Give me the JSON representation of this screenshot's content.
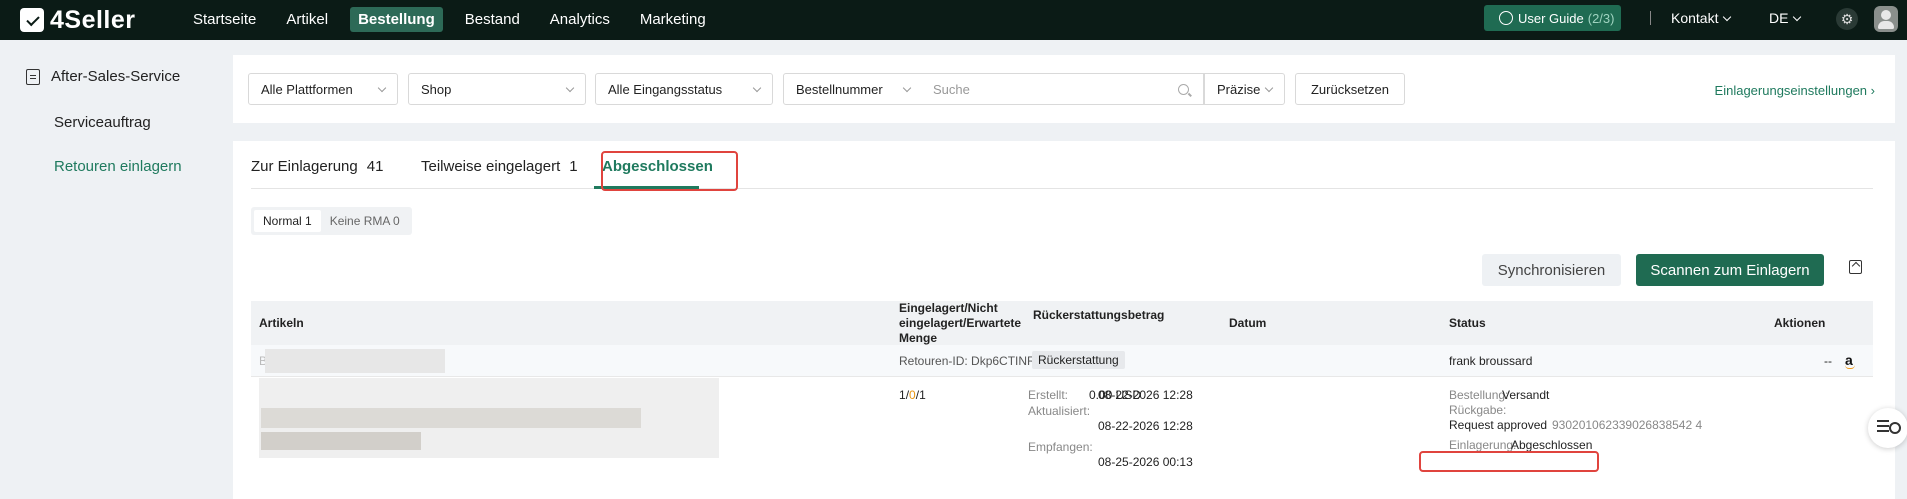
{
  "app": {
    "brand": "4Seller"
  },
  "topnav": {
    "items": [
      "Startseite",
      "Artikel",
      "Bestellung",
      "Bestand",
      "Analytics",
      "Marketing"
    ],
    "active": "Bestellung",
    "guide_label": "User Guide",
    "guide_count": "(2/3)",
    "contact": "Kontakt",
    "language": "DE"
  },
  "sidebar": {
    "section": "After-Sales-Service",
    "items": [
      "Serviceauftrag",
      "Retouren einlagern"
    ],
    "active": "Retouren einlagern"
  },
  "filters": {
    "platform": "Alle Plattformen",
    "shop": "Shop",
    "status": "Alle Eingangsstatus",
    "search_field": "Bestellnummer",
    "search_placeholder": "Suche",
    "match_mode": "Präzise",
    "reset": "Zurücksetzen",
    "settings_link": "Einlagerungseinstellungen"
  },
  "tabs": [
    {
      "label": "Zur Einlagerung",
      "count": "41"
    },
    {
      "label": "Teilweise eingelagert",
      "count": "1"
    },
    {
      "label": "Abgeschlossen",
      "count": ""
    }
  ],
  "segments": [
    "Normal 1",
    "Keine RMA 0"
  ],
  "actions": {
    "sync": "Synchronisieren",
    "scan": "Scannen zum Einlagern"
  },
  "table": {
    "headers": {
      "artikel": "Artikeln",
      "menge": "Eingelagert/Nicht eingelagert/Erwartete Menge",
      "refund": "Rückerstattungsbetrag",
      "datum": "Datum",
      "status": "Status",
      "aktionen": "Aktionen"
    },
    "group": {
      "prefix": "B",
      "rma": "Retouren-ID: Dkp6CTINRR...",
      "tag": "Rückerstattung",
      "customer": "frank broussard",
      "action": "--"
    },
    "row": {
      "qty_in": "1",
      "qty_sep": "/",
      "qty_pending": "0",
      "qty_expected": "1",
      "amount": "0.00 USD",
      "created_label": "Erstellt:",
      "created": "08-22-2026 12:28",
      "updated_label": "Aktualisiert:",
      "updated": "08-22-2026 12:28",
      "received_label": "Empfangen:",
      "received": "08-25-2026 00:13",
      "order_label": "Bestellung:",
      "order_status": "Versandt",
      "return_label": "Rückgabe:",
      "return_status": "Request approved",
      "tracking": "930201062339026838542 4",
      "storage_label": "Einlagerung:",
      "storage_status": "Abgeschlossen"
    }
  },
  "colors": {
    "brand": "#1f6b52",
    "accent": "#1f7a5e",
    "topbar": "#0b1b16",
    "highlight": "#e0443e"
  }
}
